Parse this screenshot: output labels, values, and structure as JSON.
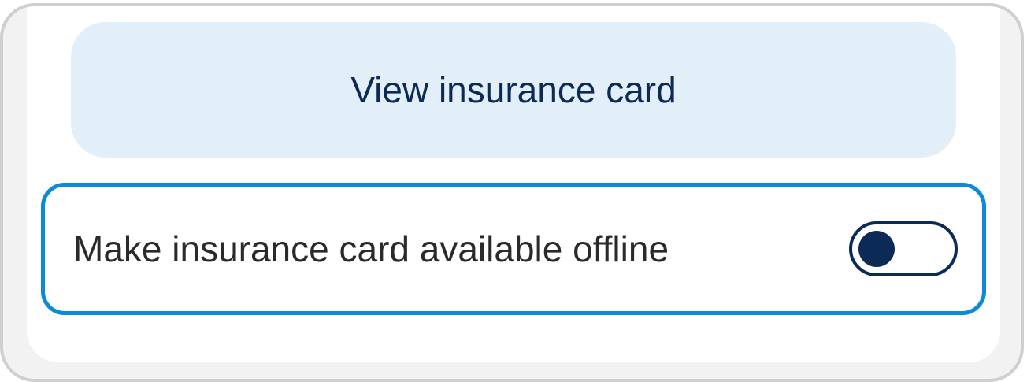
{
  "insurance_card": {
    "view_button_label": "View insurance card"
  },
  "offline_setting": {
    "label": "Make insurance card available offline",
    "toggle_on": false
  },
  "colors": {
    "accent_border": "#0a8ad9",
    "navy": "#0b2a55",
    "button_bg": "#e3eff8"
  }
}
